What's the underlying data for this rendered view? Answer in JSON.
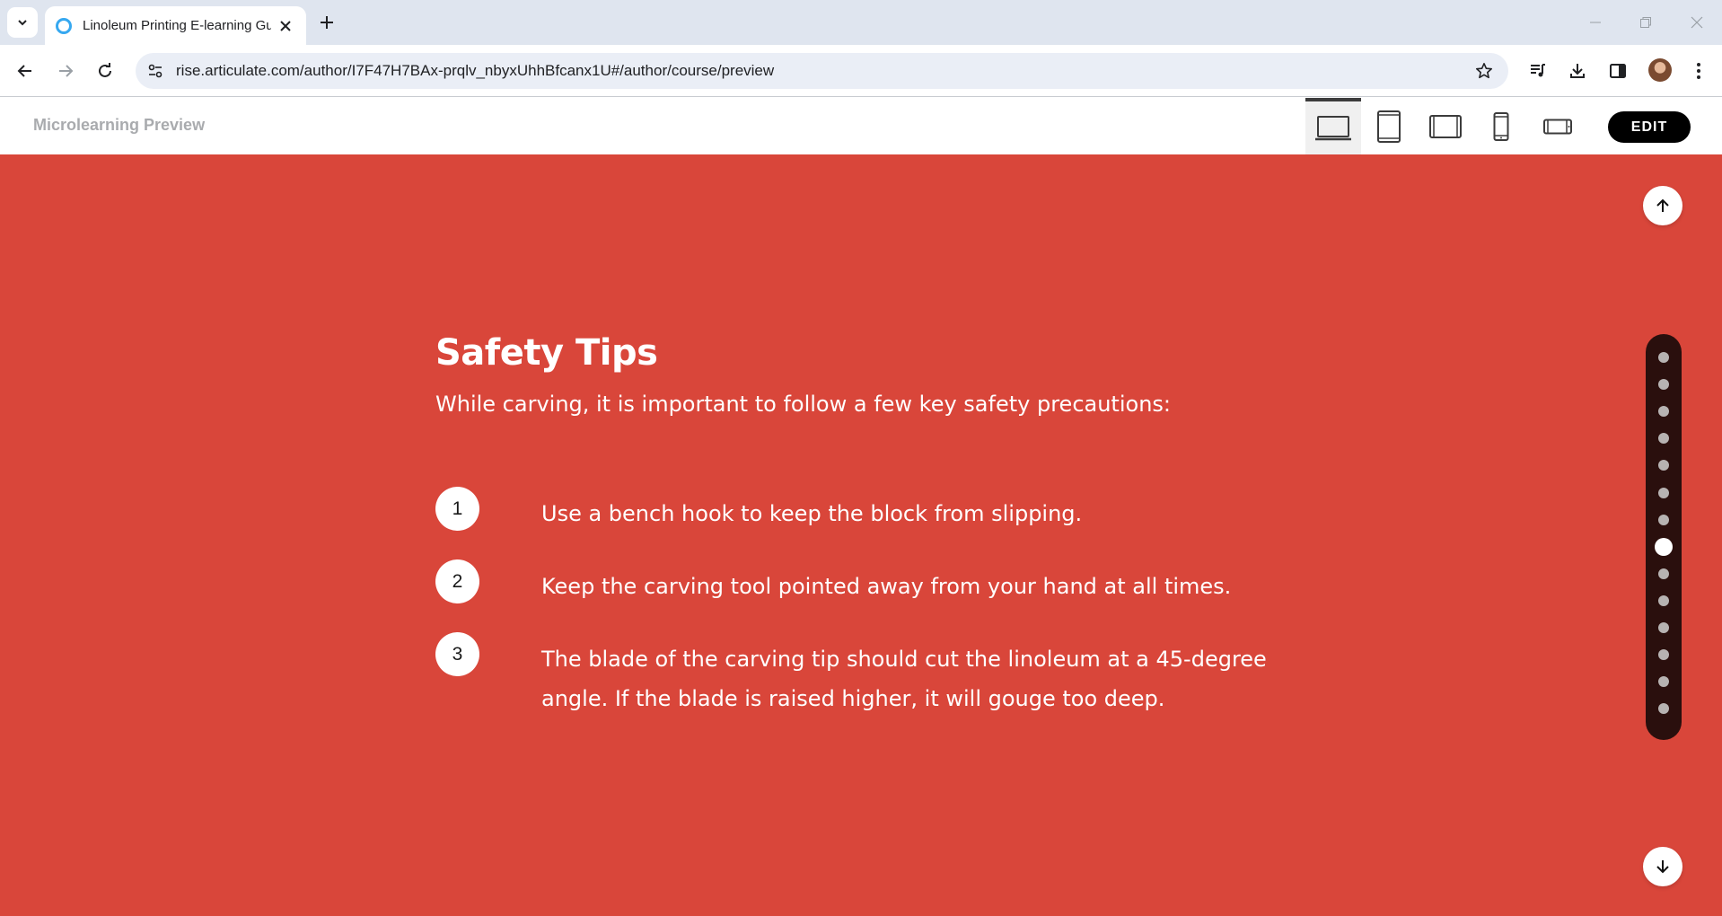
{
  "browser": {
    "tab_title": "Linoleum Printing E-learning Gu",
    "url": "rise.articulate.com/author/I7F47H7BAx-prqlv_nbyxUhhBfcanx1U#/author/course/preview"
  },
  "header": {
    "title": "Microlearning Preview",
    "devices": [
      "desktop-icon",
      "tablet-portrait-icon",
      "tablet-landscape-icon",
      "phone-portrait-icon",
      "phone-landscape-icon"
    ],
    "active_device": "desktop",
    "edit_label": "EDIT"
  },
  "lesson": {
    "heading": "Safety Tips",
    "intro": "While carving, it is important to follow a few key safety precautions:",
    "steps": [
      {
        "number": "1",
        "text": "Use a bench hook to keep the block from slipping."
      },
      {
        "number": "2",
        "text": "Keep the carving tool pointed away from your hand at all times."
      },
      {
        "number": "3",
        "text": "The blade of the carving tip should cut the linoleum at a 45-degree angle. If the blade is raised higher, it will gouge too deep."
      }
    ]
  },
  "progress": {
    "total_sections": 14,
    "current_section": 8
  },
  "colors": {
    "content_bg": "#d9463a",
    "rail_bg": "#2a0f0d",
    "tab_strip_bg": "#dfe5ef"
  }
}
